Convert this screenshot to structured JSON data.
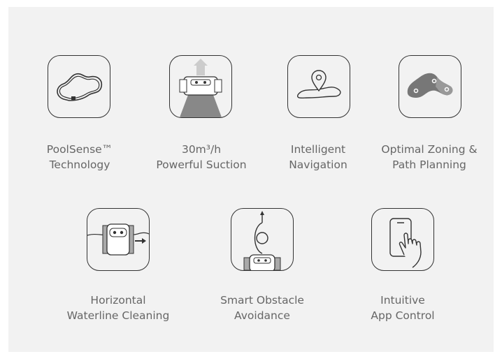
{
  "features": [
    {
      "line1": "PoolSense™",
      "line2": "Technology",
      "icon": "pool-path-icon"
    },
    {
      "line1": "30m³/h",
      "line2": "Powerful Suction",
      "icon": "suction-robot-icon"
    },
    {
      "line1": "Intelligent",
      "line2": "Navigation",
      "icon": "navigation-pin-icon"
    },
    {
      "line1": "Optimal Zoning &",
      "line2": "Path Planning",
      "icon": "zoning-map-icon"
    },
    {
      "line1": "Horizontal",
      "line2": "Waterline Cleaning",
      "icon": "waterline-robot-icon"
    },
    {
      "line1": "Smart Obstacle",
      "line2": "Avoidance",
      "icon": "obstacle-avoidance-icon"
    },
    {
      "line1": "Intuitive",
      "line2": "App Control",
      "icon": "phone-touch-icon"
    }
  ]
}
